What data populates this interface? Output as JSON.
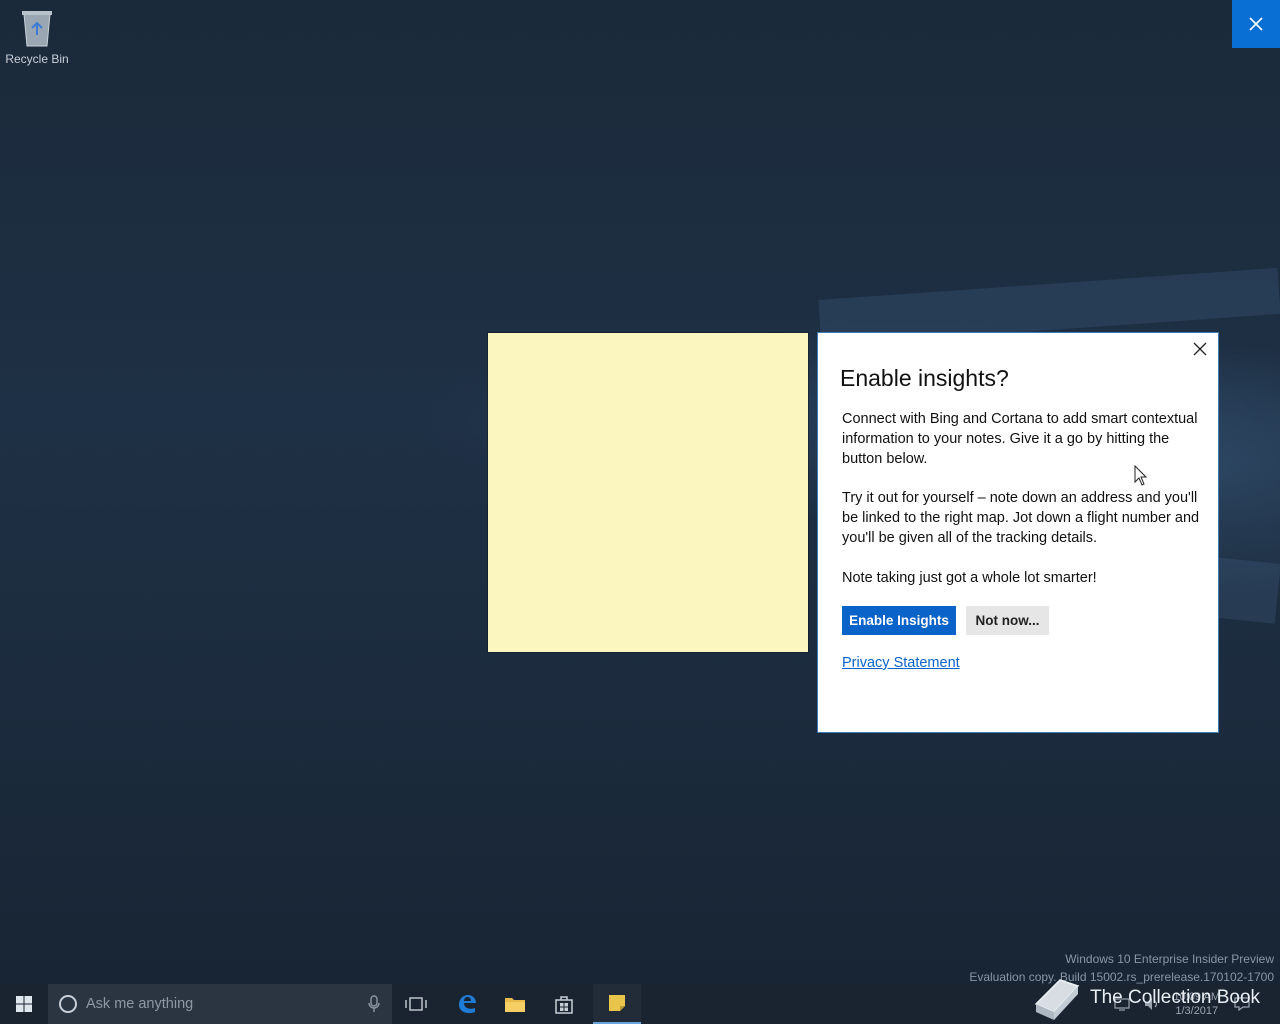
{
  "desktop": {
    "recycle_bin_label": "Recycle Bin",
    "watermark_line1": "Windows 10 Enterprise Insider Preview",
    "watermark_line2": "Evaluation copy. Build 15002.rs_prerelease.170102-1700"
  },
  "dialog": {
    "title": "Enable insights?",
    "para1": "Connect with Bing and Cortana to add smart contextual information to your notes. Give it a go by hitting the button below.",
    "para2": "Try it out for yourself – note down an address and you'll be linked to the right map. Jot down a flight number and you'll be given all of the tracking details.",
    "para3": "Note taking just got a whole lot smarter!",
    "enable_label": "Enable Insights",
    "not_now_label": "Not now...",
    "privacy_label": "Privacy Statement"
  },
  "taskbar": {
    "search_placeholder": "Ask me anything",
    "clock_time": "10:09 AM",
    "clock_date": "1/3/2017"
  },
  "overlay": {
    "brand_text": "The Collection Book"
  },
  "colors": {
    "accent": "#0a63c8",
    "sticky_note": "#fbf5c0",
    "taskbar": "#1a2430"
  }
}
